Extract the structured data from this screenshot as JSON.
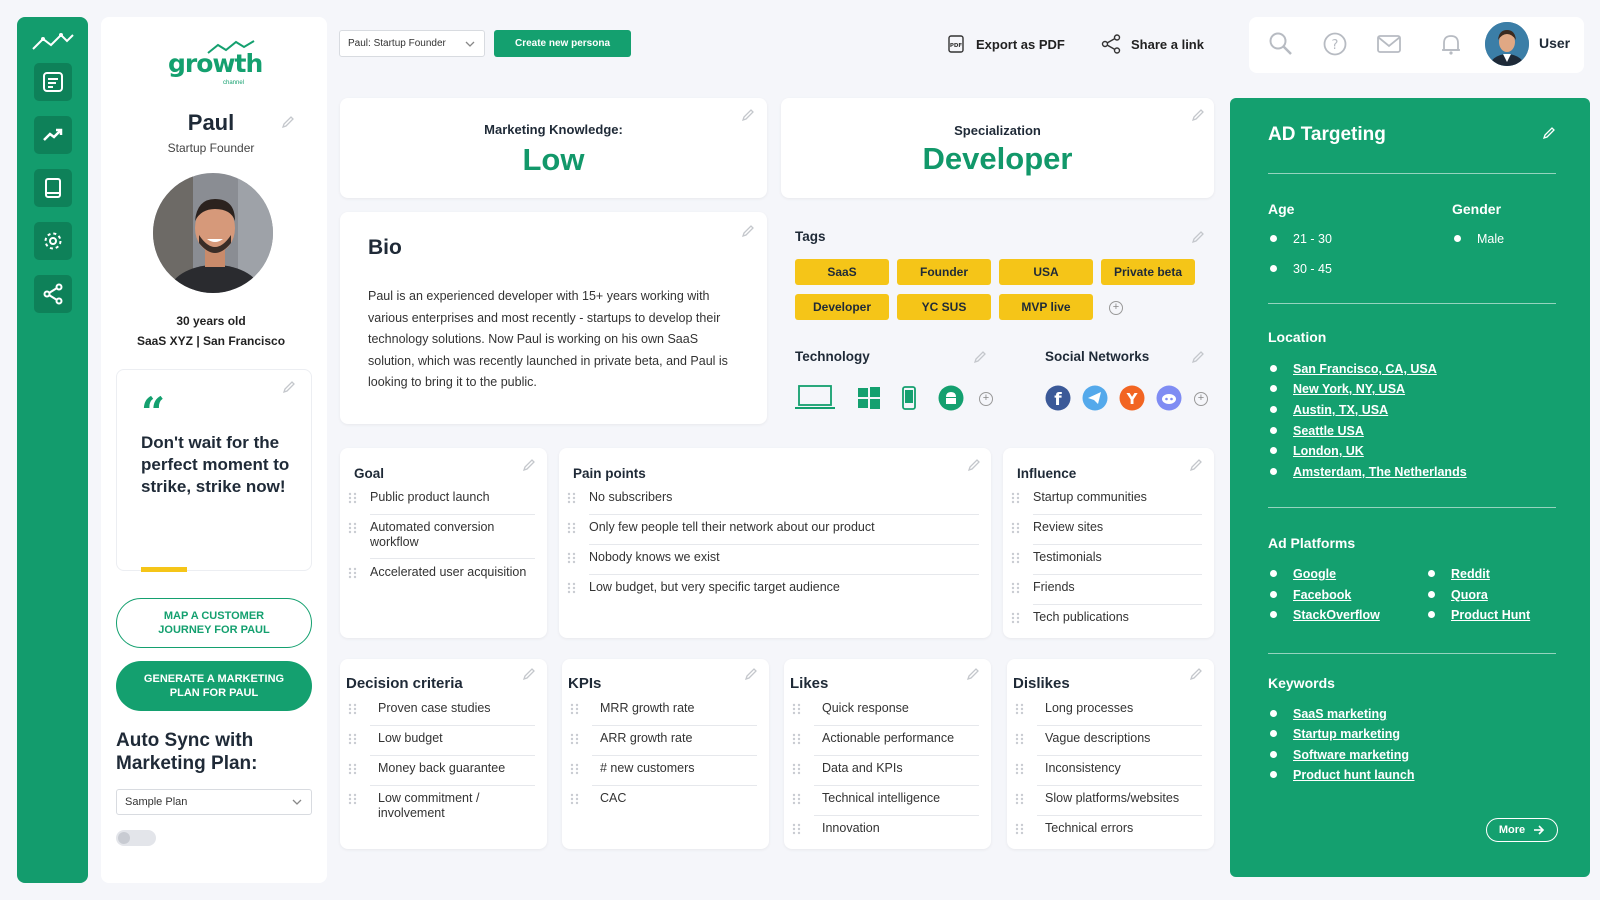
{
  "rail": {
    "items": [
      "notes",
      "analytics",
      "book",
      "settings",
      "share"
    ]
  },
  "profile": {
    "logo_text": "growth",
    "logo_sub": "channel",
    "name": "Paul",
    "role": "Startup Founder",
    "age": "30 years old",
    "company": "SaaS XYZ | San Francisco",
    "quote": "Don't wait for the perfect moment to strike, strike now!",
    "btn_journey": "MAP A CUSTOMER JOURNEY FOR PAUL",
    "btn_plan": "GENERATE A MARKETING PLAN FOR PAUL",
    "sync_title": "Auto Sync with Marketing Plan:",
    "sync_select": "Sample Plan"
  },
  "topbar": {
    "persona_select": "Paul: Startup Founder",
    "create_label": "Create new persona",
    "export_label": "Export as PDF",
    "share_label": "Share a link",
    "user_label": "User"
  },
  "knowledge": {
    "label": "Marketing Knowledge:",
    "value": "Low"
  },
  "specialization": {
    "label": "Specialization",
    "value": "Developer"
  },
  "bio": {
    "title": "Bio",
    "text": "Paul is an experienced developer with 15+ years working with various enterprises and most recently - startups to develop their technology solutions. Now Paul is working on his own SaaS solution, which was recently launched in private beta, and Paul is looking to bring it to the public."
  },
  "tags": {
    "title": "Tags",
    "items": [
      "SaaS",
      "Founder",
      "USA",
      "Private beta",
      "Developer",
      "YC SUS",
      "MVP live"
    ]
  },
  "technology": {
    "title": "Technology",
    "icons": [
      "laptop-icon",
      "windows-icon",
      "phone-icon",
      "android-icon"
    ]
  },
  "social": {
    "title": "Social Networks",
    "icons": [
      "facebook-icon",
      "telegram-icon",
      "ycombinator-icon",
      "discord-icon"
    ]
  },
  "goal": {
    "title": "Goal",
    "items": [
      "Public product launch",
      "Automated conversion workflow",
      "Accelerated user acquisition"
    ]
  },
  "pain": {
    "title": "Pain points",
    "items": [
      "No subscribers",
      "Only few people tell their network about our product",
      "Nobody knows we exist",
      "Low budget, but very specific target audience"
    ]
  },
  "influence": {
    "title": "Influence",
    "items": [
      "Startup communities",
      "Review sites",
      "Testimonials",
      "Friends",
      "Tech publications"
    ]
  },
  "decision": {
    "title": "Decision criteria",
    "items": [
      "Proven case studies",
      "Low budget",
      "Money back guarantee",
      "Low commitment / involvement"
    ]
  },
  "kpis": {
    "title": "KPIs",
    "items": [
      "MRR growth rate",
      "ARR growth rate",
      "# new customers",
      "CAC"
    ]
  },
  "likes": {
    "title": "Likes",
    "items": [
      "Quick response",
      "Actionable performance",
      "Data and KPIs",
      "Technical intelligence",
      "Innovation"
    ]
  },
  "dislikes": {
    "title": "Dislikes",
    "items": [
      "Long processes",
      "Vague descriptions",
      "Inconsistency",
      "Slow platforms/websites",
      "Technical errors"
    ]
  },
  "ad": {
    "title": "AD Targeting",
    "age_title": "Age",
    "ages": [
      "21 - 30",
      "30 - 45"
    ],
    "gender_title": "Gender",
    "genders": [
      "Male"
    ],
    "location_title": "Location",
    "locations": [
      "San Francisco, CA, USA",
      "New York, NY, USA",
      "Austin, TX, USA",
      "Seattle USA",
      "London, UK",
      "Amsterdam, The Netherlands"
    ],
    "platforms_title": "Ad Platforms",
    "platforms_left": [
      "Google",
      "Facebook",
      "StackOverflow"
    ],
    "platforms_right": [
      "Reddit",
      "Quora",
      "Product Hunt"
    ],
    "keywords_title": "Keywords",
    "keywords": [
      "SaaS marketing",
      "Startup marketing",
      "Software marketing",
      "Product hunt launch"
    ],
    "more_label": "More"
  },
  "colors": {
    "brand": "#14a06f",
    "tag": "#f5c518",
    "background": "#f5f6fa"
  }
}
